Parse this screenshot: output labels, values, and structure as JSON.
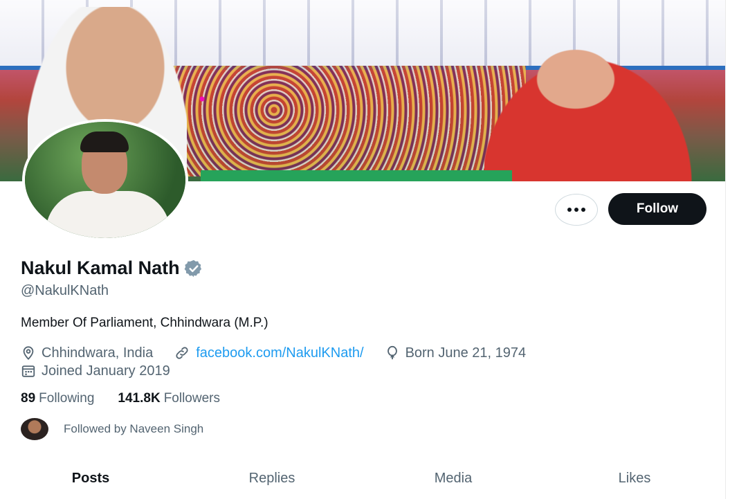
{
  "profile": {
    "name": "Nakul Kamal Nath",
    "handle": "@NakulKNath",
    "bio": "Member Of Parliament, Chhindwara (M.P.)",
    "location": "Chhindwara, India",
    "website": "facebook.com/NakulKNath/",
    "birthday": "Born June 21, 1974",
    "joined": "Joined January 2019",
    "verified_icon": "verified-badge-icon"
  },
  "actions": {
    "more_label": "···",
    "follow_label": "Follow"
  },
  "stats": {
    "following_count": "89",
    "following_label": "Following",
    "followers_count": "141.8K",
    "followers_label": "Followers"
  },
  "followed_by": "Followed by Naveen Singh",
  "tabs": [
    {
      "label": "Posts"
    },
    {
      "label": "Replies"
    },
    {
      "label": "Media"
    },
    {
      "label": "Likes"
    }
  ],
  "colors": {
    "accent": "#1d9bf0",
    "text": "#0f1419",
    "muted": "#536471",
    "follow_bg": "#0f1419"
  }
}
